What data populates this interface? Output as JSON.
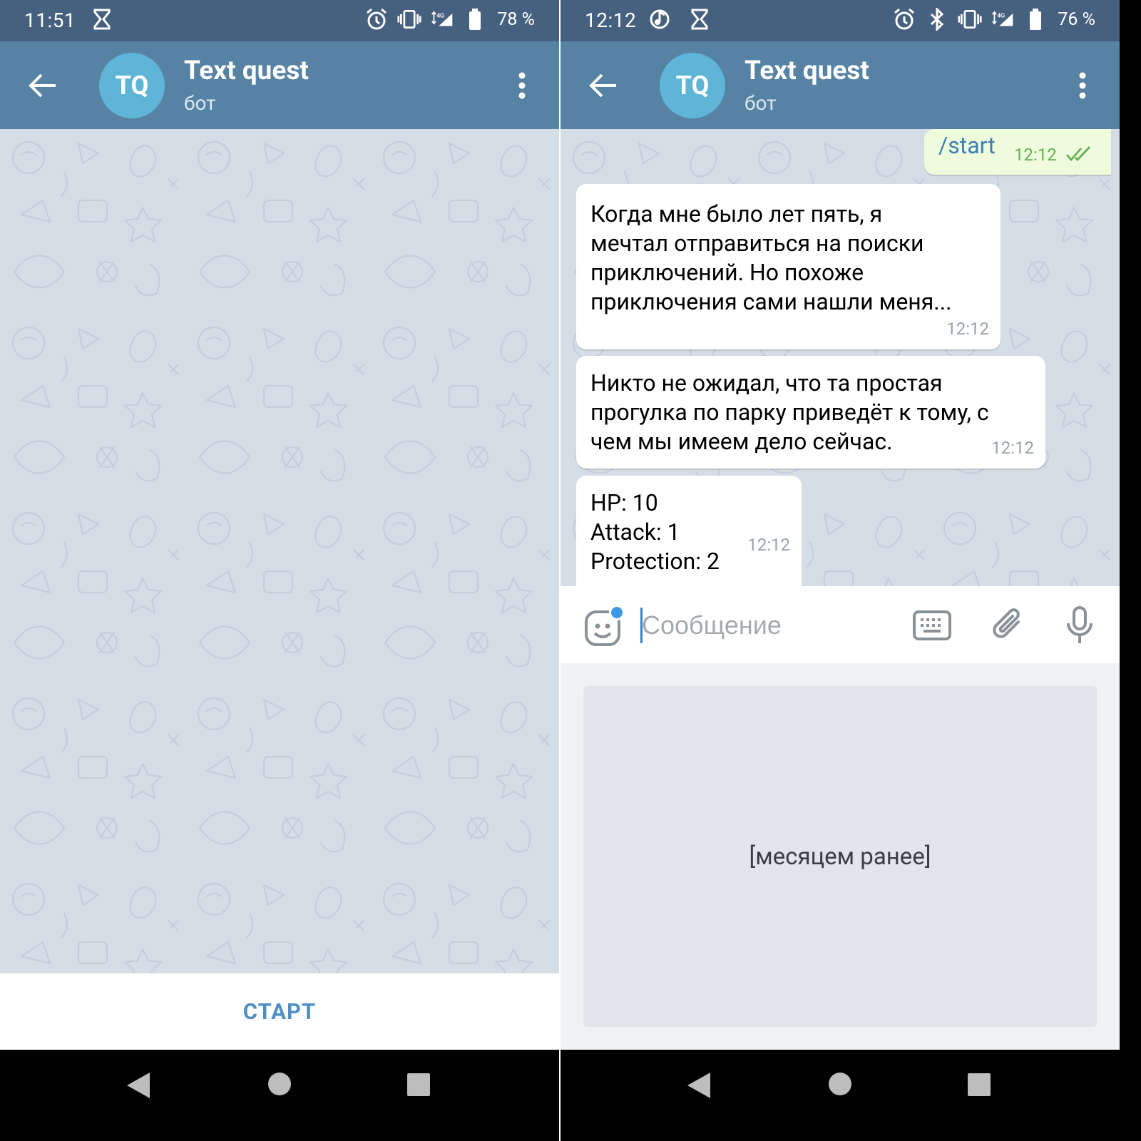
{
  "left": {
    "status_bar": {
      "time": "11:51",
      "battery": "78 %",
      "network": "4G"
    },
    "chat": {
      "avatar_initials": "TQ",
      "title": "Text quest",
      "subtitle": "бот"
    },
    "start_button": "СТАРТ"
  },
  "right": {
    "status_bar": {
      "time": "12:12",
      "battery": "76 %",
      "network": "4G"
    },
    "chat": {
      "avatar_initials": "TQ",
      "title": "Text quest",
      "subtitle": "бот"
    },
    "messages": [
      {
        "type": "outgoing",
        "text": "/start",
        "time": "12:12"
      },
      {
        "type": "incoming",
        "lines": [
          "Когда мне было лет пять, я",
          "мечтал отправиться на поиски",
          "приключений. Но похоже",
          "приключения сами нашли меня..."
        ],
        "time": "12:12"
      },
      {
        "type": "incoming",
        "lines": [
          "Никто не ожидал, что та простая",
          "прогулка по парку приведёт к тому, с",
          "чем мы имеем дело сейчас."
        ],
        "time": "12:12"
      },
      {
        "type": "incoming",
        "lines": [
          "HP: 10",
          "Attack: 1",
          "Protection: 2"
        ],
        "time": "12:12"
      }
    ],
    "input": {
      "placeholder": "Сообщение",
      "value": ""
    },
    "panel_text": "[месяцем ранее]"
  },
  "colors": {
    "status_bar": "#46617f",
    "app_bar": "#5682a3",
    "avatar": "#5eb5d6",
    "wallpaper": "#d5dde6",
    "outgoing_bubble": "#eefbdc",
    "accent": "#4f8fc4"
  },
  "icons": [
    "back-arrow-icon",
    "more-vert-icon",
    "hourglass-icon",
    "alarm-icon",
    "vibrate-icon",
    "signal-icon",
    "battery-icon",
    "bluetooth-icon",
    "music-note-icon",
    "emoji-icon",
    "keyboard-icon",
    "paperclip-icon",
    "microphone-icon",
    "double-check-icon",
    "nav-back-icon",
    "nav-home-icon",
    "nav-recent-icon"
  ]
}
